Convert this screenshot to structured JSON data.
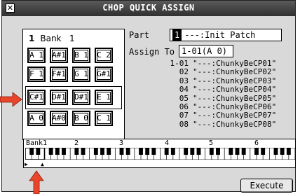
{
  "dialog": {
    "title": "CHOP QUICK ASSIGN",
    "close_glyph": "✕"
  },
  "pads": {
    "bank_number": "1",
    "bank_label": "Bank",
    "bank_value": "1",
    "rows": [
      [
        "A 1",
        "A#1",
        "B 1",
        "C 2"
      ],
      [
        "F 1",
        "F#1",
        "G 1",
        "G#1"
      ],
      [
        "C#1",
        "D#1",
        "D#1",
        "E 1"
      ],
      [
        "A 0",
        "A#0",
        "B 0",
        "C 1"
      ]
    ]
  },
  "part": {
    "label": "Part",
    "number": "1",
    "value": "---:Init Patch"
  },
  "assign_to": {
    "label": "Assign To",
    "value": "1-01(A 0)"
  },
  "assignments": [
    {
      "num": "1-01",
      "name": "\"---:ChunkyBeCP01\""
    },
    {
      "num": "02",
      "name": "\"---:ChunkyBeCP02\""
    },
    {
      "num": "03",
      "name": "\"---:ChunkyBeCP03\""
    },
    {
      "num": "04",
      "name": "\"---:ChunkyBeCP04\""
    },
    {
      "num": "05",
      "name": "\"---:ChunkyBeCP05\""
    },
    {
      "num": "06",
      "name": "\"---:ChunkyBeCP06\""
    },
    {
      "num": "07",
      "name": "\"---:ChunkyBeCP07\""
    },
    {
      "num": "08",
      "name": "\"---:ChunkyBeCP08\""
    }
  ],
  "keyboard": {
    "bank_labels": [
      "Bank1",
      "2",
      "3",
      "4",
      "5",
      "6"
    ]
  },
  "execute_label": "Execute",
  "colors": {
    "arrow": "#e8452b",
    "titlebar": "#3c3c3c",
    "background": "#d9d9d9"
  }
}
